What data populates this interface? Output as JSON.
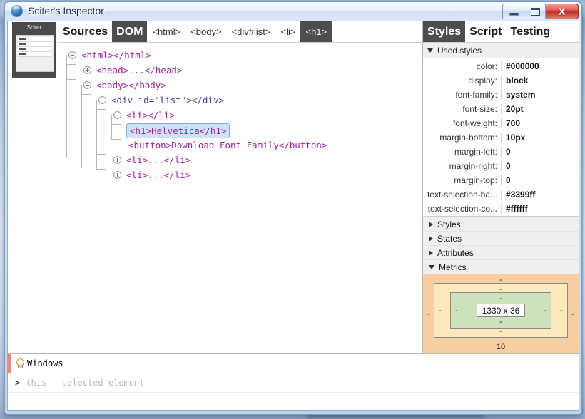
{
  "window": {
    "title": "Sciter's Inspector",
    "icon": "sciter-globe-icon",
    "controls": {
      "minimize_label": "–",
      "maximize_label": "□",
      "close_label": "X"
    }
  },
  "sidebar": {
    "preview_title": "Sciter"
  },
  "dom_panel": {
    "tabs": [
      {
        "label": "Sources",
        "active": false
      },
      {
        "label": "DOM",
        "active": true
      }
    ],
    "breadcrumbs": [
      {
        "label": "<html>",
        "active": false
      },
      {
        "label": "<body>",
        "active": false
      },
      {
        "label": "<div#list>",
        "active": false
      },
      {
        "label": "<li>",
        "active": false
      },
      {
        "label": "<h1>",
        "active": true
      }
    ],
    "tree": [
      {
        "id": "html",
        "indent": 0,
        "toggle": "minus",
        "text": "<html></html>",
        "selected": false
      },
      {
        "id": "head",
        "indent": 1,
        "toggle": "plus",
        "text": "<head>...</head>",
        "selected": false
      },
      {
        "id": "body",
        "indent": 1,
        "toggle": "minus",
        "text": "<body></body>",
        "selected": false
      },
      {
        "id": "div",
        "indent": 2,
        "toggle": "minus",
        "text": "<div id=\"list\"></div>",
        "selected": false
      },
      {
        "id": "li1",
        "indent": 3,
        "toggle": "minus",
        "text": "<li></li>",
        "selected": false
      },
      {
        "id": "h1",
        "indent": 4,
        "toggle": "none",
        "text": "<h1>Helvetica</h1>",
        "selected": true
      },
      {
        "id": "button",
        "indent": 4,
        "toggle": "none",
        "text": "<button>Download Font Family</button>",
        "selected": false
      },
      {
        "id": "li2",
        "indent": 3,
        "toggle": "plus",
        "text": "<li>...</li>",
        "selected": false
      },
      {
        "id": "li3",
        "indent": 3,
        "toggle": "plus",
        "text": "<li>...</li>",
        "selected": false
      }
    ]
  },
  "styles_panel": {
    "tabs": [
      {
        "label": "Styles",
        "active": true
      },
      {
        "label": "Script",
        "active": false
      },
      {
        "label": "Testing",
        "active": false
      }
    ],
    "used_styles_header": "Used styles",
    "properties": [
      {
        "name": "color:",
        "value": "#000000"
      },
      {
        "name": "display:",
        "value": "block"
      },
      {
        "name": "font-family:",
        "value": "system"
      },
      {
        "name": "font-size:",
        "value": "20pt"
      },
      {
        "name": "font-weight:",
        "value": "700"
      },
      {
        "name": "margin-bottom:",
        "value": "10px"
      },
      {
        "name": "margin-left:",
        "value": "0"
      },
      {
        "name": "margin-right:",
        "value": "0"
      },
      {
        "name": "margin-top:",
        "value": "0"
      },
      {
        "name": "text-selection-ba...",
        "value": "#3399ff"
      },
      {
        "name": "text-selection-co...",
        "value": "#ffffff"
      }
    ],
    "sections": [
      {
        "label": "Styles",
        "expanded": false
      },
      {
        "label": "States",
        "expanded": false
      },
      {
        "label": "Attributes",
        "expanded": false
      },
      {
        "label": "Metrics",
        "expanded": true
      }
    ],
    "metrics": {
      "content_size": "1330 x 36",
      "margin_top": "-",
      "margin_right": "-",
      "margin_bottom": "10",
      "margin_left": "-",
      "border_top": "-",
      "border_right": "-",
      "border_bottom": "-",
      "border_left": "-",
      "padding_top": "-",
      "padding_right": "-",
      "padding_bottom": "-",
      "padding_left": "-",
      "colors": {
        "margin_box": "#f6cfa0",
        "border_box": "#fce9be",
        "padding_box": "#cfe0bd",
        "content_box": "#ffffff"
      }
    }
  },
  "console": {
    "log_icon": "lightbulb-icon",
    "log_text": "Windows",
    "prompt_symbol": ">",
    "prompt_placeholder": "this - selected element"
  }
}
